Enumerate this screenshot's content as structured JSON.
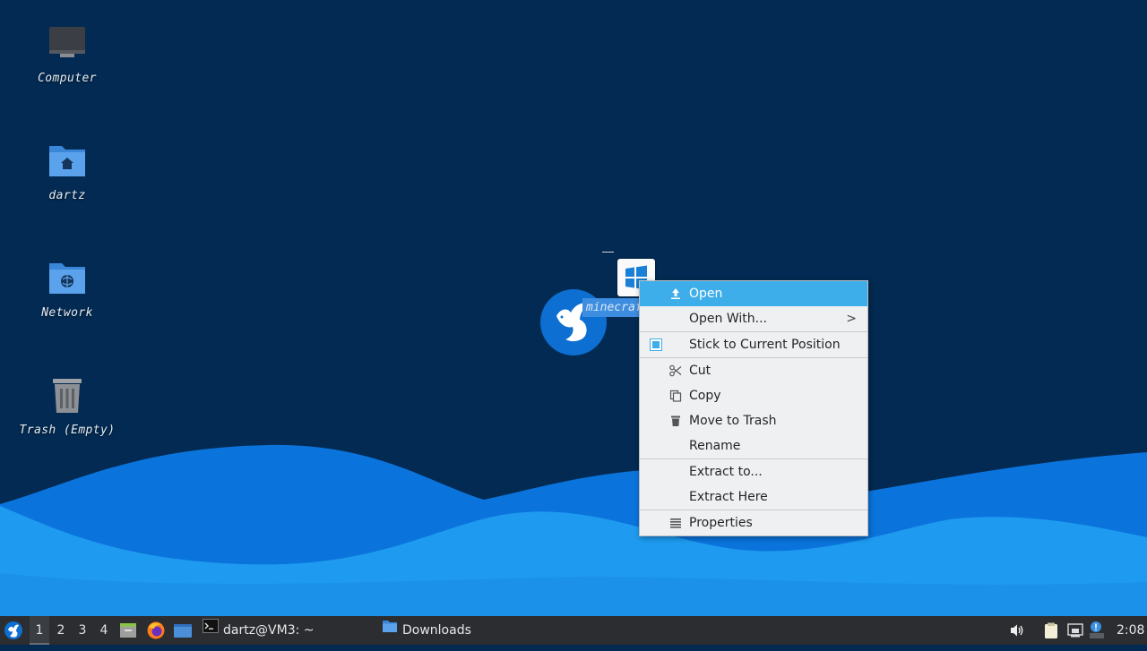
{
  "desktop": {
    "icons": [
      {
        "label": "Computer",
        "icon": "computer-icon"
      },
      {
        "label": "dartz",
        "icon": "home-folder-icon"
      },
      {
        "label": "Network",
        "icon": "network-folder-icon"
      },
      {
        "label": "Trash (Empty)",
        "icon": "trash-icon"
      }
    ],
    "selected_file": {
      "label": "minecraft",
      "icon": "windows-executable-icon"
    },
    "bird_icon": "lubuntu-bird-icon",
    "colors": {
      "background": "#032a52",
      "wave_light": "#1e9bf0",
      "wave_dark": "#0a70d8",
      "highlight": "#3daee9"
    }
  },
  "context_menu": {
    "open": "Open",
    "open_with": "Open With...",
    "stick": "Stick to Current Position",
    "cut": "Cut",
    "copy": "Copy",
    "move_to_trash": "Move to Trash",
    "rename": "Rename",
    "extract_to": "Extract to...",
    "extract_here": "Extract Here",
    "properties": "Properties",
    "submenu_arrow": ">"
  },
  "taskbar": {
    "workspaces": [
      "1",
      "2",
      "3",
      "4"
    ],
    "active_workspace": "1",
    "tasks": [
      {
        "label": "dartz@VM3: ~",
        "icon": "terminal-icon"
      },
      {
        "label": "Downloads",
        "icon": "folder-icon"
      }
    ],
    "clock": "2:08"
  }
}
